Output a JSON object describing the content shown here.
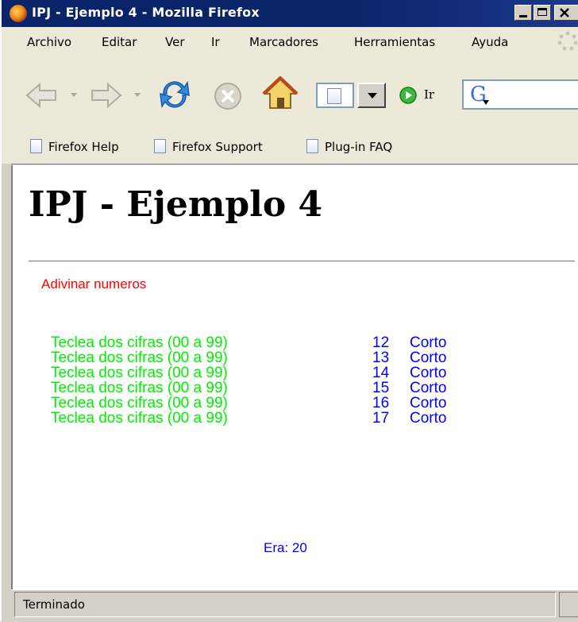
{
  "window": {
    "title": "IPJ - Ejemplo 4 - Mozilla Firefox"
  },
  "menubar": {
    "items": [
      "Archivo",
      "Editar",
      "Ver",
      "Ir",
      "Marcadores",
      "Herramientas",
      "Ayuda"
    ]
  },
  "toolbar": {
    "go_label": "Ir"
  },
  "bookmarks": {
    "items": [
      "Firefox Help",
      "Firefox Support",
      "Plug-in FAQ"
    ]
  },
  "page": {
    "heading": "IPJ - Ejemplo 4",
    "subtitle": "Adivinar numeros",
    "rows": [
      {
        "prompt": "Teclea dos cifras (00 a 99)",
        "number": "12",
        "result": "Corto"
      },
      {
        "prompt": "Teclea dos cifras (00 a 99)",
        "number": "13",
        "result": "Corto"
      },
      {
        "prompt": "Teclea dos cifras (00 a 99)",
        "number": "14",
        "result": "Corto"
      },
      {
        "prompt": "Teclea dos cifras (00 a 99)",
        "number": "15",
        "result": "Corto"
      },
      {
        "prompt": "Teclea dos cifras (00 a 99)",
        "number": "16",
        "result": "Corto"
      },
      {
        "prompt": "Teclea dos cifras (00 a 99)",
        "number": "17",
        "result": "Corto"
      }
    ],
    "answer": "Era: 20"
  },
  "statusbar": {
    "text": "Terminado"
  },
  "colors": {
    "titlebar": "#0a246a",
    "prompt_text": "#00ee00",
    "result_text": "#0000ff",
    "subtitle_text": "#ff0000"
  }
}
